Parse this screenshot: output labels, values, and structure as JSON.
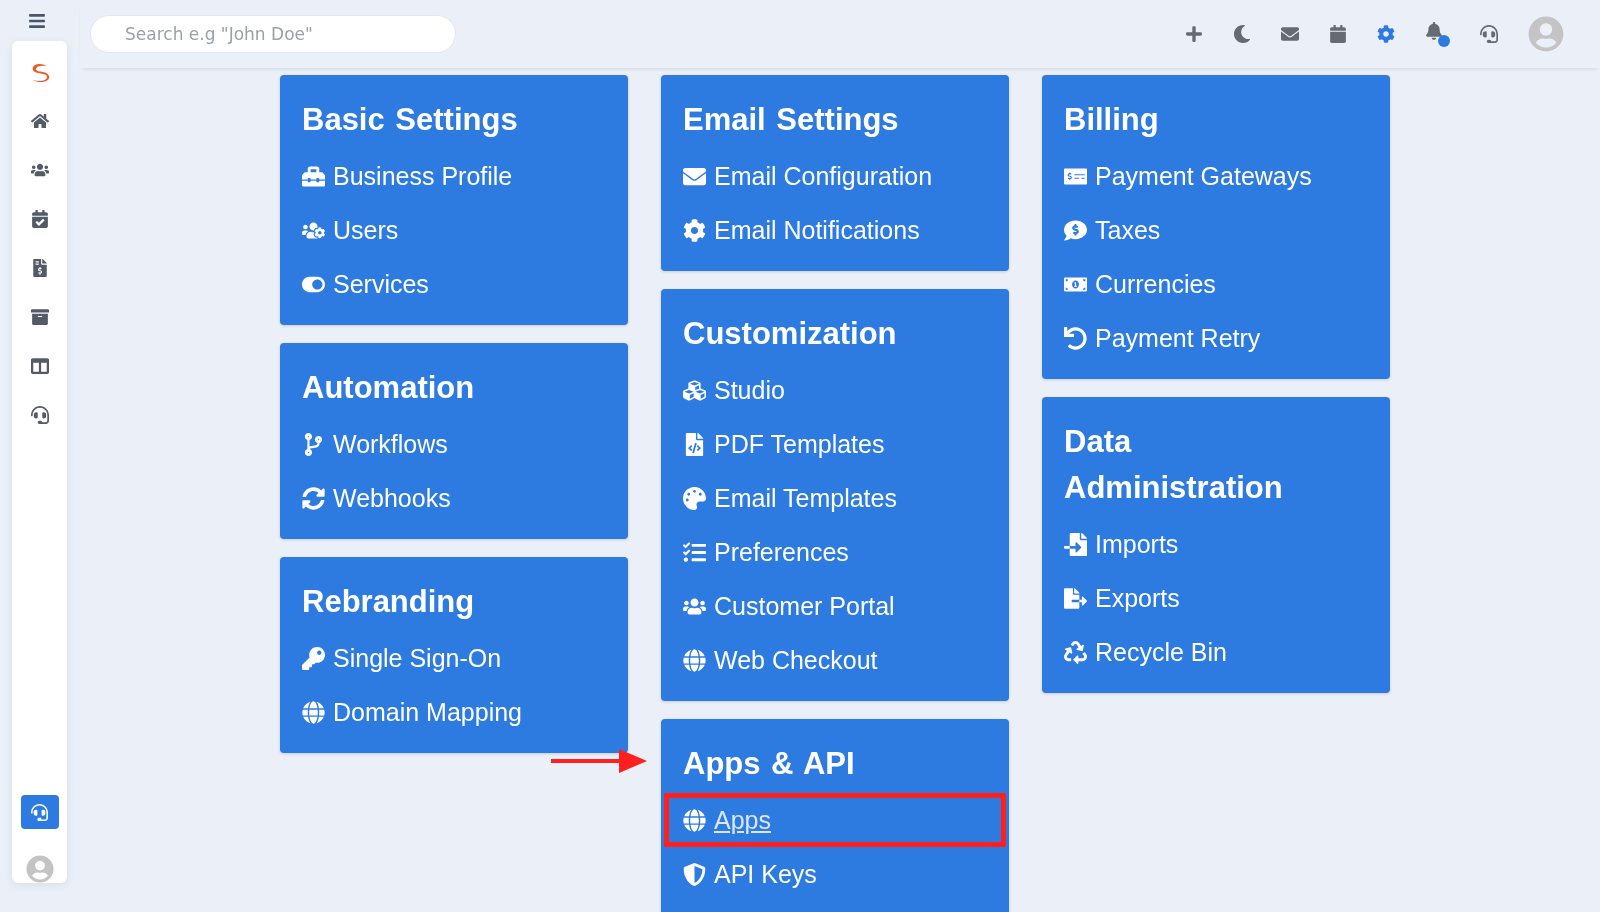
{
  "search": {
    "placeholder": "Search e.g \"John Doe\""
  },
  "columns": [
    {
      "cards": [
        {
          "title": "Basic Settings",
          "items": [
            {
              "label": "Business Profile",
              "highlighted": false
            },
            {
              "label": "Users",
              "highlighted": false
            },
            {
              "label": "Services",
              "highlighted": false
            }
          ]
        },
        {
          "title": "Automation",
          "items": [
            {
              "label": "Workflows",
              "highlighted": false
            },
            {
              "label": "Webhooks",
              "highlighted": false
            }
          ]
        },
        {
          "title": "Rebranding",
          "items": [
            {
              "label": "Single Sign-On",
              "highlighted": false
            },
            {
              "label": "Domain Mapping",
              "highlighted": false
            }
          ]
        }
      ]
    },
    {
      "cards": [
        {
          "title": "Email Settings",
          "items": [
            {
              "label": "Email Configuration",
              "highlighted": false
            },
            {
              "label": "Email Notifications",
              "highlighted": false
            }
          ]
        },
        {
          "title": "Customization",
          "items": [
            {
              "label": "Studio",
              "highlighted": false
            },
            {
              "label": "PDF Templates",
              "highlighted": false
            },
            {
              "label": "Email Templates",
              "highlighted": false
            },
            {
              "label": "Preferences",
              "highlighted": false
            },
            {
              "label": "Customer Portal",
              "highlighted": false
            },
            {
              "label": "Web Checkout",
              "highlighted": false
            }
          ]
        },
        {
          "title": "Apps & API",
          "items": [
            {
              "label": "Apps",
              "highlighted": true
            },
            {
              "label": "API Keys",
              "highlighted": false
            }
          ]
        }
      ]
    },
    {
      "cards": [
        {
          "title": "Billing",
          "items": [
            {
              "label": "Payment Gateways",
              "highlighted": false
            },
            {
              "label": "Taxes",
              "highlighted": false
            },
            {
              "label": "Currencies",
              "highlighted": false
            },
            {
              "label": "Payment Retry",
              "highlighted": false
            }
          ]
        },
        {
          "title": "Data Administration",
          "items": [
            {
              "label": "Imports",
              "highlighted": false
            },
            {
              "label": "Exports",
              "highlighted": false
            },
            {
              "label": "Recycle Bin",
              "highlighted": false
            }
          ]
        }
      ]
    }
  ]
}
